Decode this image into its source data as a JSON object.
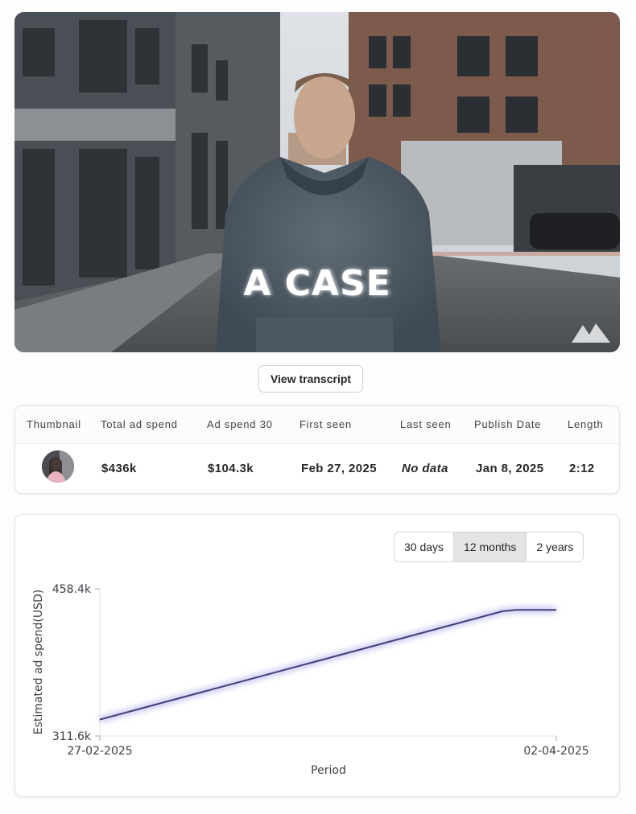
{
  "video": {
    "overlay_text": "A CASE",
    "logo_icon": "mountain-logo-icon"
  },
  "transcript_button": {
    "label": "View transcript"
  },
  "stats": {
    "headers": [
      "Thumbnail",
      "Total ad spend",
      "Ad spend 30",
      "First seen",
      "Last seen",
      "Publish Date",
      "Length"
    ],
    "row": {
      "thumbnail_icon": "avatar-thumbnail",
      "total_ad_spend": "$436k",
      "ad_spend_30": "$104.3k",
      "first_seen": "Feb 27, 2025",
      "last_seen": "No data",
      "publish_date": "Jan 8, 2025",
      "length": "2:12"
    }
  },
  "range_selector": {
    "options": [
      "30 days",
      "12 months",
      "2 years"
    ],
    "selected": "12 months"
  },
  "colors": {
    "line": "#3f3f7a",
    "line_glow": "#8c86e6",
    "active_range_bg": "#e4e4e7"
  },
  "chart_data": {
    "type": "line",
    "xlabel": "Period",
    "ylabel": "Estimated ad spend(USD)",
    "x_tick_labels": [
      "27-02-2025",
      "02-04-2025"
    ],
    "y_tick_labels": [
      "458.4k",
      "311.6k"
    ],
    "ylim": [
      311.6,
      458.4
    ],
    "y_unit": "k USD",
    "grid": false,
    "series": [
      {
        "x": [
          "2025-02-27",
          "2025-03-29",
          "2025-03-30",
          "2025-04-02"
        ],
        "y": [
          328,
          436,
          437.3,
          437.3
        ]
      }
    ]
  }
}
